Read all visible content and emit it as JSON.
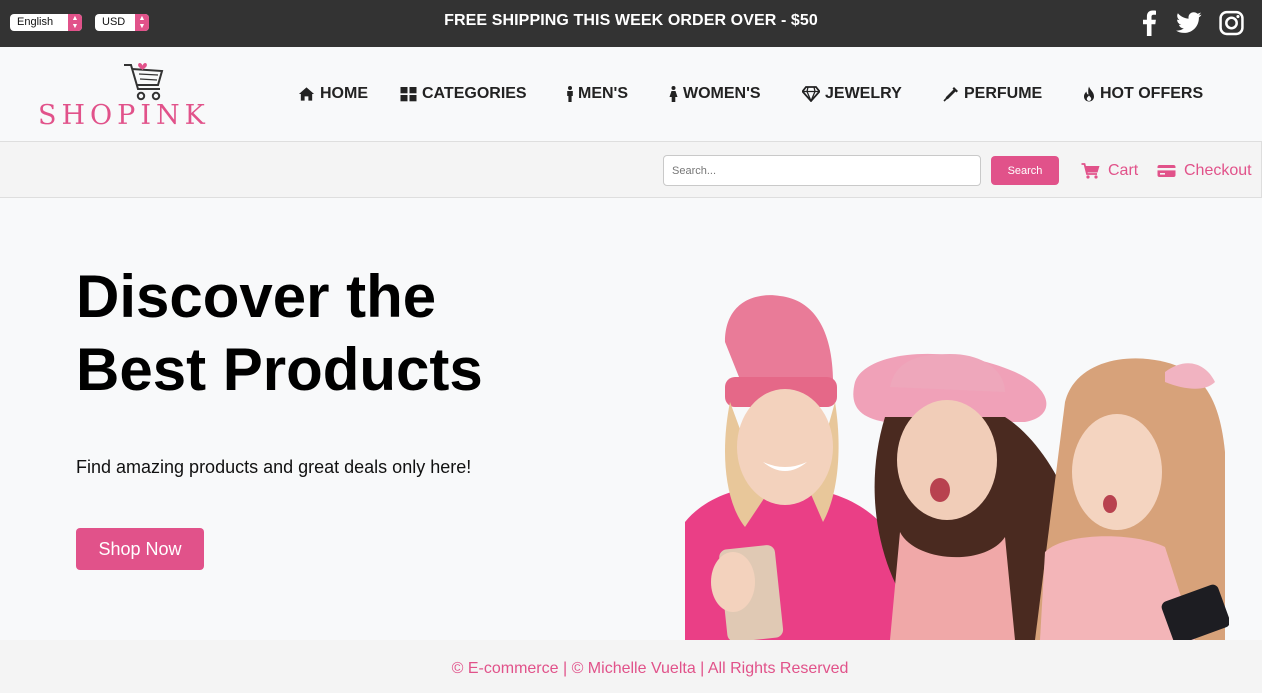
{
  "topbar": {
    "language": "English",
    "currency": "USD",
    "promo": "FREE SHIPPING THIS WEEK ORDER OVER - $50",
    "social": [
      "facebook-icon",
      "twitter-icon",
      "instagram-icon"
    ]
  },
  "brand": {
    "name": "SHOPINK",
    "color": "#e1528a"
  },
  "nav": {
    "items": [
      {
        "label": "HOME",
        "icon": "home-icon"
      },
      {
        "label": "CATEGORIES",
        "icon": "grid-icon"
      },
      {
        "label": "MEN'S",
        "icon": "male-icon"
      },
      {
        "label": "WOMEN'S",
        "icon": "female-icon"
      },
      {
        "label": "JEWELRY",
        "icon": "diamond-icon"
      },
      {
        "label": "PERFUME",
        "icon": "perfume-icon"
      },
      {
        "label": "HOT OFFERS",
        "icon": "fire-icon"
      }
    ]
  },
  "search": {
    "placeholder": "Search...",
    "button_label": "Search",
    "cart_label": "Cart",
    "checkout_label": "Checkout"
  },
  "hero": {
    "title_line1": "Discover the",
    "title_line2": "Best Products",
    "subtitle": "Find amazing products and great deals only here!",
    "cta_label": "Shop Now",
    "image_alt": "hero-photo"
  },
  "footer": {
    "text": "© E-commerce | © Michelle Vuelta | All Rights Reserved"
  },
  "colors": {
    "accent": "#e1528a",
    "topbar_bg": "#333333",
    "page_bg": "#f8f9fa"
  }
}
